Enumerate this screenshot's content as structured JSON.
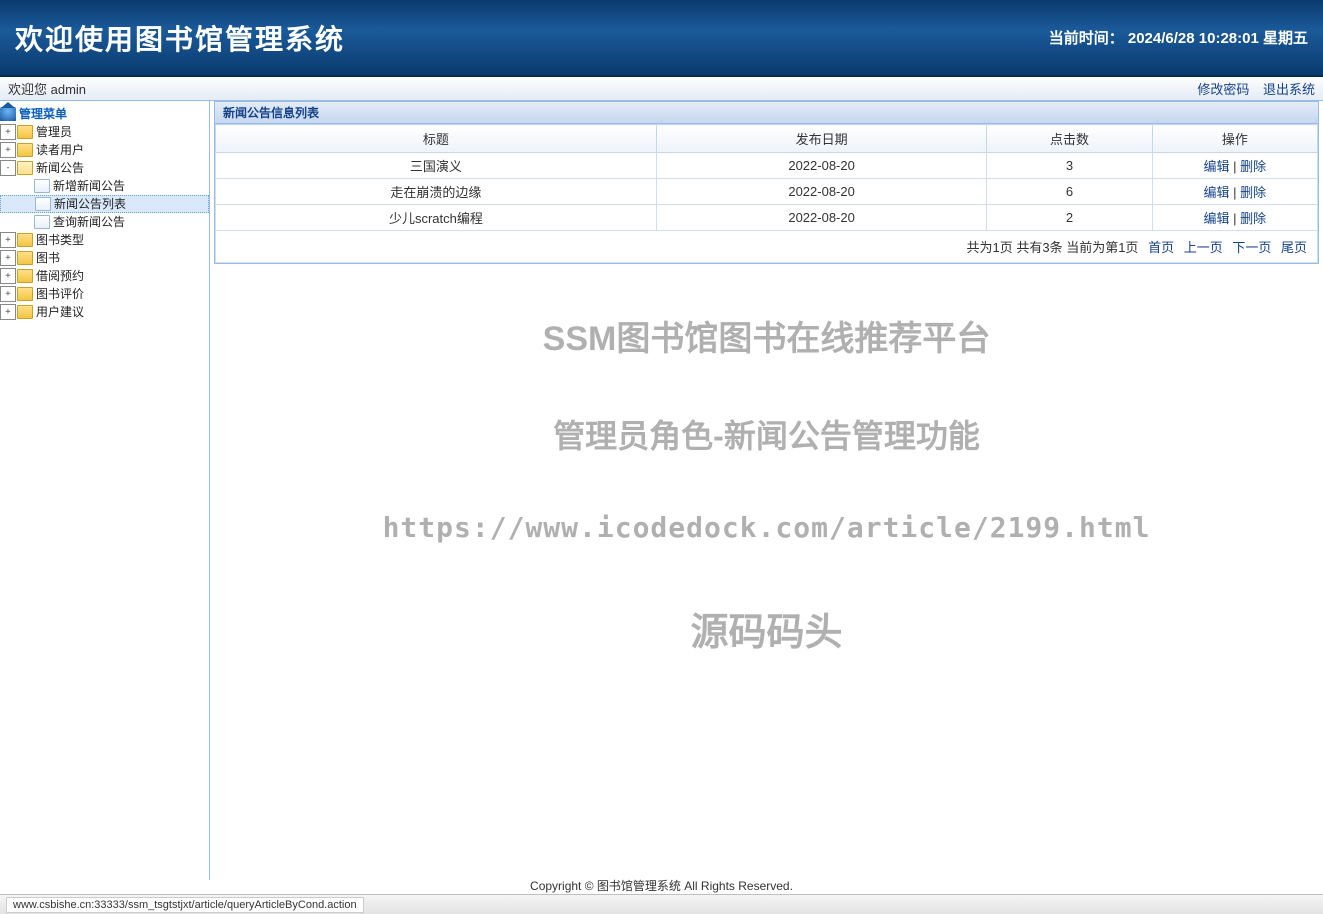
{
  "header": {
    "title": "欢迎使用图书馆管理系统",
    "time_label": "当前时间：",
    "time_value": "2024/6/28 10:28:01 星期五"
  },
  "toolbar": {
    "welcome": "欢迎您 admin",
    "change_pwd": "修改密码",
    "logout": "退出系统"
  },
  "sidebar": {
    "root": "管理菜单",
    "items": [
      {
        "label": "管理员",
        "expanded": false
      },
      {
        "label": "读者用户",
        "expanded": false
      },
      {
        "label": "新闻公告",
        "expanded": true,
        "children": [
          {
            "label": "新增新闻公告"
          },
          {
            "label": "新闻公告列表",
            "selected": true
          },
          {
            "label": "查询新闻公告"
          }
        ]
      },
      {
        "label": "图书类型",
        "expanded": false
      },
      {
        "label": "图书",
        "expanded": false
      },
      {
        "label": "借阅预约",
        "expanded": false
      },
      {
        "label": "图书评价",
        "expanded": false
      },
      {
        "label": "用户建议",
        "expanded": false
      }
    ]
  },
  "panel": {
    "title": "新闻公告信息列表"
  },
  "table": {
    "headers": [
      "标题",
      "发布日期",
      "点击数",
      "操作"
    ],
    "rows": [
      {
        "title": "三国演义",
        "date": "2022-08-20",
        "hits": "3"
      },
      {
        "title": "走在崩溃的边缘",
        "date": "2022-08-20",
        "hits": "6"
      },
      {
        "title": "少儿scratch编程",
        "date": "2022-08-20",
        "hits": "2"
      }
    ],
    "op_edit": "编辑",
    "op_sep": " | ",
    "op_delete": "删除"
  },
  "pager": {
    "summary": "共为1页  共有3条  当前为第1页",
    "first": "首页",
    "prev": "上一页",
    "next": "下一页",
    "last": "尾页"
  },
  "watermark": {
    "line1": "SSM图书馆图书在线推荐平台",
    "line2": "管理员角色-新闻公告管理功能",
    "line3": "https://www.icodedock.com/article/2199.html",
    "line4": "源码码头"
  },
  "footer": {
    "text": "Copyright © 图书馆管理系统 All Rights Reserved."
  },
  "statusbar": {
    "url": "www.csbishe.cn:33333/ssm_tsgtstjxt/article/queryArticleByCond.action"
  }
}
